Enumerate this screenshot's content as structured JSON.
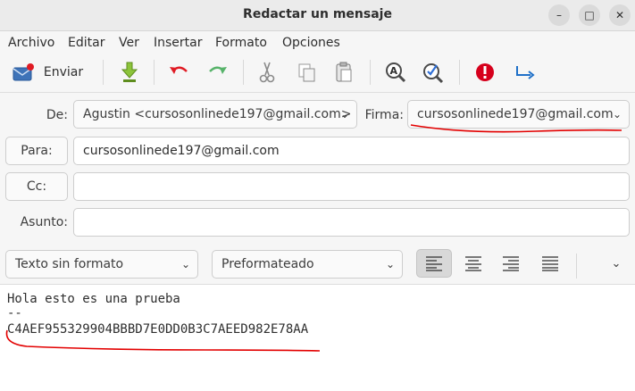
{
  "window": {
    "title": "Redactar un mensaje",
    "controls": {
      "minimize": "–",
      "maximize": "□",
      "close": "✕"
    }
  },
  "menu": [
    "Archivo",
    "Editar",
    "Ver",
    "Insertar",
    "Formato",
    "Opciones"
  ],
  "toolbar": {
    "send_label": "Enviar",
    "icons": [
      "send-mail-icon",
      "attach-download-icon",
      "undo-icon",
      "redo-icon",
      "cut-icon",
      "copy-icon",
      "paste-icon",
      "find-replace-icon",
      "spellcheck-icon",
      "priority-icon",
      "return-receipt-icon"
    ]
  },
  "header": {
    "from_label": "De:",
    "from_value": "Agustin <cursosonlinede197@gmail.com>",
    "signature_label": "Firma:",
    "signature_value": "cursosonlinede197@gmail.com",
    "to_label": "Para:",
    "to_value": "cursosonlinede197@gmail.com",
    "cc_label": "Cc:",
    "cc_value": "",
    "subject_label": "Asunto:",
    "subject_value": ""
  },
  "format": {
    "text_format": "Texto sin formato",
    "paragraph_style": "Preformateado",
    "align_icons": [
      "align-left-icon",
      "align-center-icon",
      "align-right-icon",
      "align-justify-icon"
    ],
    "active_alignment": "left"
  },
  "message": {
    "line1": "Hola esto es una prueba",
    "line2": "--",
    "line3": "C4AEF955329904BBBD7E0DD0B3C7AEED982E78AA"
  },
  "colors": {
    "annotation": "#e30000",
    "priority": "#d6001c",
    "send_accent": "#1f70c8"
  }
}
